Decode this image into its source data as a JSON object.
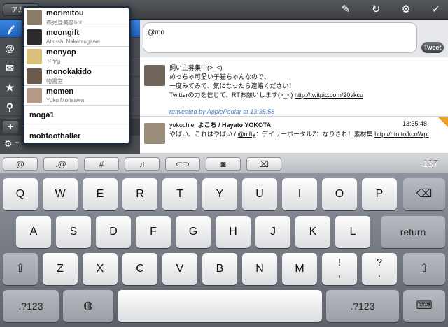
{
  "sidebar": {
    "account_button": "アカウ",
    "rows": [
      {
        "icon": "𝒻",
        "name": "sidebar-item-timeline",
        "active": true
      },
      {
        "icon": "@",
        "name": "sidebar-item-mentions"
      },
      {
        "icon": "✉",
        "name": "sidebar-item-messages"
      },
      {
        "icon": "★",
        "name": "sidebar-item-favorites"
      },
      {
        "icon": "⚲",
        "name": "sidebar-item-search"
      }
    ],
    "add_label": "+",
    "settings_icon": "⚙",
    "settings_label": "T"
  },
  "suggestions": [
    {
      "name": "morimitou",
      "sub": "森見登美彦bot",
      "color": "#8a7a66"
    },
    {
      "name": "moongift",
      "sub": "Atsushi Nakatsugawa",
      "color": "#2c2c2c"
    },
    {
      "name": "monyop",
      "sub": "ドヤp",
      "color": "#d9c079"
    },
    {
      "name": "monokakido",
      "sub": "物書堂",
      "color": "#6b5a4a"
    },
    {
      "name": "momen",
      "sub": "Yuko Morisawa",
      "color": "#b39a86"
    },
    {
      "name": "moga1",
      "sub": ""
    },
    {
      "name": "mobfootballer",
      "sub": ""
    }
  ],
  "toolbar": {
    "compose_icon": "✎",
    "refresh_icon": "↻",
    "settings_icon": "⚙",
    "done_icon": "✓"
  },
  "compose": {
    "value": "@mo",
    "tweet_label": "Tweet"
  },
  "tweets": [
    {
      "lines": [
        "飼い主募集中(>_<)",
        "めっちゃ可愛い子猫ちゃんなので、",
        "一度みてみて、気になったら連絡ください！"
      ],
      "last_text": "Twitterの力を信じて、RTお願いします(>_<) ",
      "link": "http://twitpic.com/20vkcu",
      "retweeted_by": "retweeted by ApplePedlar at 13:35:58",
      "avatar_color": "#6f6459"
    },
    {
      "user": "yokochie",
      "fullname": "よこち / Hayato YOKOTA",
      "time": "13:35:48",
      "text": "やばい。これはやばい / ",
      "mention": "@nifty",
      "text2": "：デイリーポータルZ：なりきれ！素材集 ",
      "link": "http://htn.to/kcoWpt",
      "avatar_color": "#9a8e7a"
    }
  ],
  "shortcuts": [
    {
      "label": "@",
      "name": "at-shortcut-button"
    },
    {
      "label": ".@",
      "name": "dot-at-shortcut-button"
    },
    {
      "label": "#",
      "name": "hashtag-shortcut-button"
    },
    {
      "label": "♫",
      "name": "music-shortcut-button"
    },
    {
      "label": "⊂⊃",
      "name": "link-shortcut-button"
    },
    {
      "label": "◙",
      "name": "camera-shortcut-button"
    },
    {
      "label": "⌧",
      "name": "trash-shortcut-button"
    }
  ],
  "char_count": "137",
  "keyboard": {
    "row1": [
      "Q",
      "W",
      "E",
      "R",
      "T",
      "Y",
      "U",
      "I",
      "O",
      "P"
    ],
    "row2": [
      "A",
      "S",
      "D",
      "F",
      "G",
      "H",
      "J",
      "K",
      "L"
    ],
    "row3": [
      "Z",
      "X",
      "C",
      "V",
      "B",
      "N",
      "M"
    ],
    "exclam": "!",
    "comma": ",",
    "question": "?",
    "period": ".",
    "return_label": "return",
    "numbers_label": ".?123",
    "backspace_icon": "⌫",
    "shift_icon": "⇧",
    "globe_icon": "◍",
    "hide_keyboard_icon": "⌨"
  },
  "colors": {
    "accent": "#1f62c2",
    "link": "#4a7cc7",
    "flag": "#f0a020"
  }
}
